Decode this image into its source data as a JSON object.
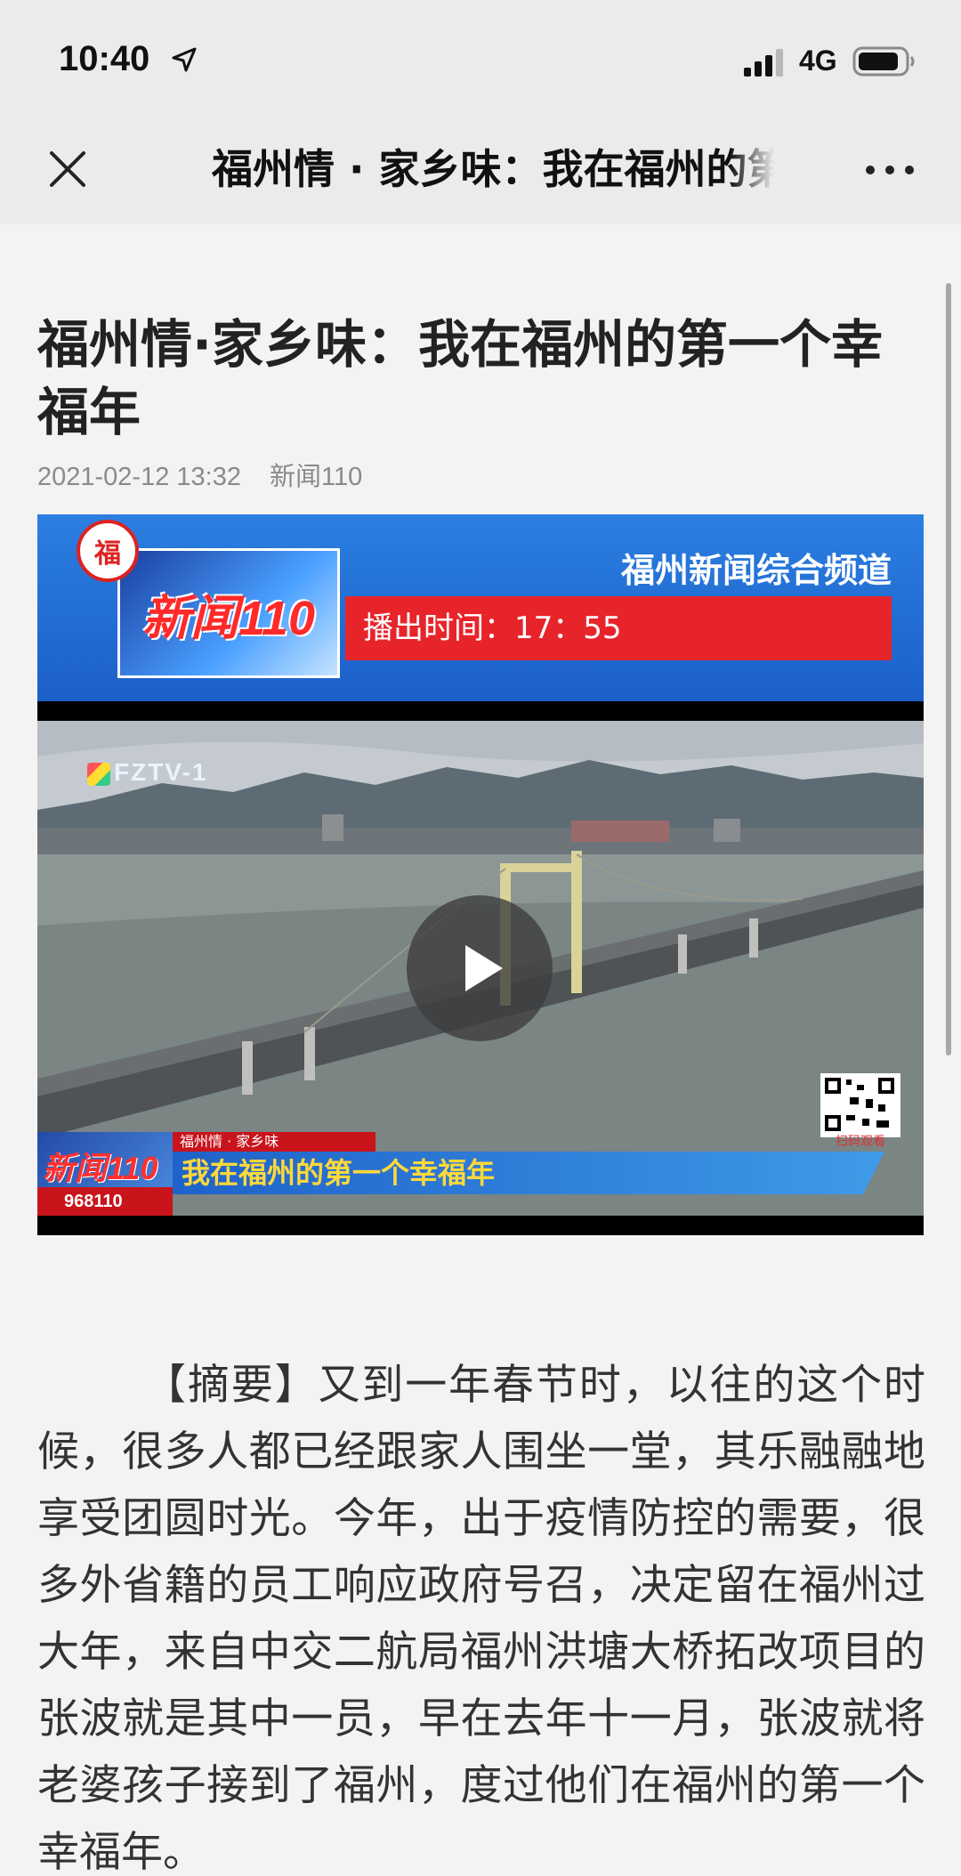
{
  "status_bar": {
    "time": "10:40",
    "network": "4G",
    "icons": [
      "location-arrow-icon",
      "cellular-signal-icon",
      "battery-icon"
    ]
  },
  "nav_bar": {
    "title": "福州情 · 家乡味：我在福州的第一个幸福年",
    "icons": [
      "close-icon",
      "more-icon"
    ]
  },
  "article": {
    "title": "福州情·家乡味：我在福州的第一个幸福年",
    "date": "2021-02-12 13:32",
    "source": "新闻110",
    "video": {
      "channel_name": "福州新闻综合频道",
      "air_time": "播出时间：17：55",
      "station_logo": "FZTV-1",
      "program_logo": "新闻110",
      "program_number": "968110",
      "kicker": "福州情 · 家乡味",
      "headline": "我在福州的第一个幸福年",
      "qr_caption": "扫码观看",
      "play_icon": "play-icon"
    },
    "summary": "【摘要】又到一年春节时，以往的这个时候，很多人都已经跟家人围坐一堂，其乐融融地享受团圆时光。今年，出于疫情防控的需要，很多外省籍的员工响应政府号召，决定留在福州过大年，来自中交二航局福州洪塘大桥拓改项目的张波就是其中一员，早在去年十一月，张波就将老婆孩子接到了福州，度过他们在福州的第一个幸福年。"
  },
  "colors": {
    "nav_background": "#ebebeb",
    "page_background": "#f3f3f3",
    "banner_blue": "#2b7fe0",
    "air_time_red": "#e8242b",
    "headline_yellow": "#ffd83a"
  }
}
